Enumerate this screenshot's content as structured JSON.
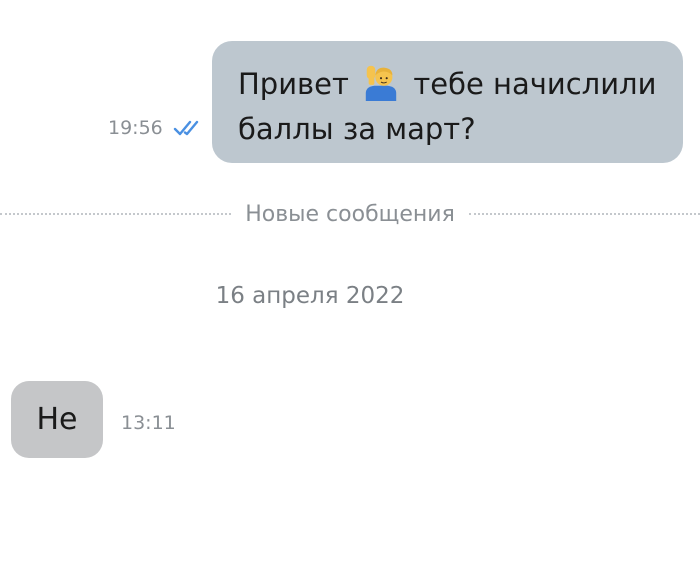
{
  "messages": [
    {
      "direction": "outgoing",
      "line1_before": "Привет",
      "emoji_icon": "person-raising-hand-icon",
      "line1_after": "тебе начислили",
      "line2": "баллы за март?",
      "time": "19:56",
      "status": "read",
      "status_icon": "double-check-icon",
      "status_color": "#4a90e2",
      "bubble_color": "#bdc7cf"
    },
    {
      "direction": "incoming",
      "text": "Не",
      "time": "13:11",
      "bubble_color": "#c5c6c8"
    }
  ],
  "new_messages_divider": {
    "label": "Новые сообщения"
  },
  "date_separator": {
    "label": "16 апреля 2022"
  }
}
